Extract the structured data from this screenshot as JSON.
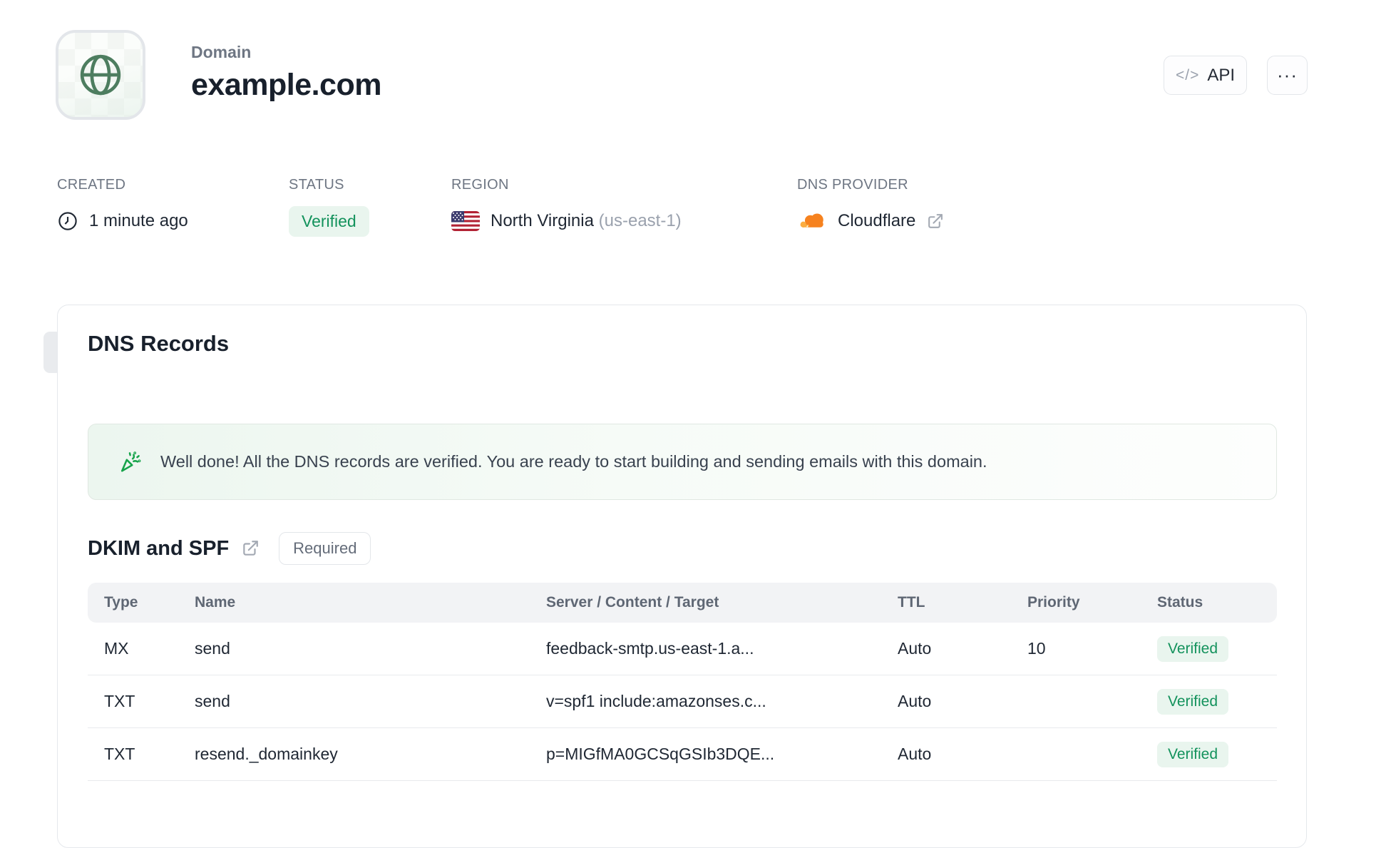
{
  "header": {
    "domain_label": "Domain",
    "domain_name": "example.com",
    "api_button_label": "API",
    "more_button_label": "···"
  },
  "meta": {
    "created": {
      "label": "CREATED",
      "value": "1 minute ago"
    },
    "status": {
      "label": "STATUS",
      "value": "Verified"
    },
    "region": {
      "label": "REGION",
      "value": "North Virginia",
      "code": "(us-east-1)"
    },
    "dns_provider": {
      "label": "DNS PROVIDER",
      "value": "Cloudflare"
    }
  },
  "dns_records": {
    "title": "DNS Records",
    "banner_message": "Well done! All the DNS records are verified. You are ready to start building and sending emails with this domain.",
    "section_title": "DKIM and SPF",
    "section_badge": "Required",
    "table": {
      "headers": [
        "Type",
        "Name",
        "Server / Content / Target",
        "TTL",
        "Priority",
        "Status"
      ],
      "rows": [
        {
          "type": "MX",
          "name": "send",
          "content": "feedback-smtp.us-east-1.a...",
          "ttl": "Auto",
          "priority": "10",
          "status": "Verified"
        },
        {
          "type": "TXT",
          "name": "send",
          "content": "v=spf1 include:amazonses.c...",
          "ttl": "Auto",
          "priority": "",
          "status": "Verified"
        },
        {
          "type": "TXT",
          "name": "resend._domainkey",
          "content": "p=MIGfMA0GCSqGSIb3DQE...",
          "ttl": "Auto",
          "priority": "",
          "status": "Verified"
        }
      ]
    }
  },
  "colors": {
    "accent_green": "#13925c",
    "badge_bg": "#e9f5ee",
    "globe_green": "#4d7d5f",
    "cloudflare_orange": "#f6821f",
    "cloudflare_light": "#fbad41"
  }
}
